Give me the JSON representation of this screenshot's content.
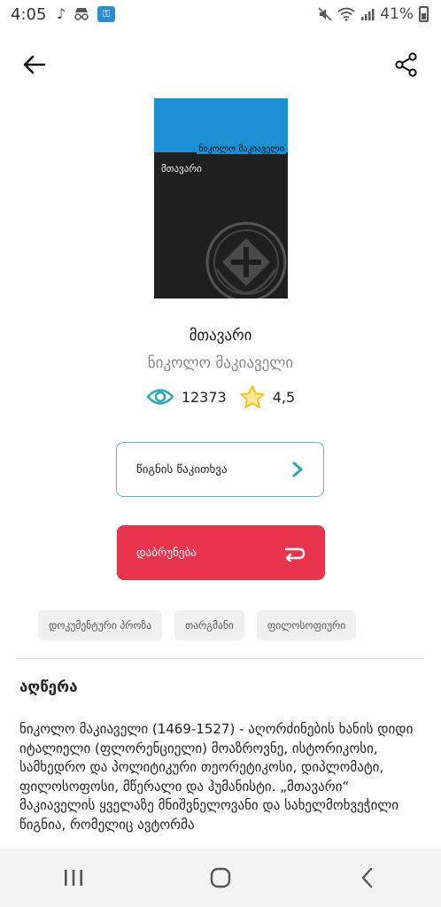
{
  "status_bar": {
    "time": "4:05",
    "battery_percent": "41%"
  },
  "book": {
    "cover_author": "ნიკოლო მაკიაველი",
    "cover_title": "მთავარი",
    "title": "მთავარი",
    "author": "ნიკოლო მაკიაველი",
    "views": "12373",
    "rating": "4,5"
  },
  "actions": {
    "read_label": "წიგნის წაკითხვა",
    "return_label": "დაბრუნება"
  },
  "tags": [
    "დოკუმენტური პროზა",
    "თარგმანი",
    "ფილოსოფიური"
  ],
  "description": {
    "heading": "აღწერა",
    "body": "ნიკოლო მაკიაველი (1469-1527) - აღორძინების ხანის დიდი იტალიელი (ფლორენციელი) მოაზროვნე, ისტორიკოსი, სამხედრო და პოლიტიკური თეორეტიკოსი, დიპლომატი, ფილოსოფოსი, მწერალი და ჰუმანისტი. „მთავარი“ მაკიაველის ყველაზე მნიშვნელოვანი და სახელმოხვეჭილი წიგნია, რომელიც ავტორმა"
  },
  "colors": {
    "accent_teal": "#2aa7b3",
    "return_red": "#e8354d",
    "cover_blue": "#1d8fd3",
    "star_yellow": "#f2c521"
  }
}
